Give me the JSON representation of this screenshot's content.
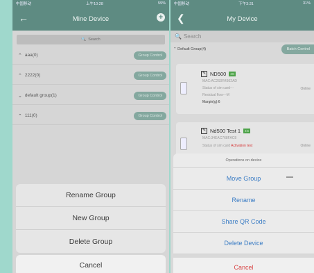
{
  "left": {
    "status": {
      "carrier": "中国移动",
      "time": "上午10:28",
      "battery": "59%"
    },
    "nav": {
      "title": "Mine Device",
      "add_icon": "+"
    },
    "search": {
      "label": "Search"
    },
    "groups": [
      {
        "name": "aaa(0)",
        "button": "Group Control",
        "expanded": false
      },
      {
        "name": "2222(0)",
        "button": "Group Control",
        "expanded": false
      },
      {
        "name": "default group(1)",
        "button": "Group Control",
        "expanded": true
      },
      {
        "name": "111(0)",
        "button": "Group Control",
        "expanded": false
      }
    ],
    "sheet": {
      "options": [
        "Rename Group",
        "New Group",
        "Delete Group"
      ],
      "cancel": "Cancel"
    }
  },
  "right": {
    "status": {
      "carrier": "中国移动",
      "time": "下午3:31",
      "battery": "31%"
    },
    "nav": {
      "title": "My Device"
    },
    "search": {
      "placeholder": "Search"
    },
    "group": {
      "name": "Default Group(4)",
      "batch": "Batch Control"
    },
    "devices": [
      {
        "name": "ND500",
        "badge": "3G",
        "mac": "MAC:AC2S0R4362AD",
        "status": "Status of sim card---",
        "residual": "Residual flow---M",
        "margin": "Margin(g):6",
        "online": "Online"
      },
      {
        "name": "Nd500 Test 1",
        "badge": "4G",
        "mac": "MAC:34EAC768FAC8",
        "status_prefix": "Status of sim card",
        "status_alert": "Activation test",
        "online": "Online"
      }
    ],
    "sheet": {
      "header": "Operations on device",
      "options": [
        "Move Group",
        "Rename",
        "Share QR Code",
        "Delete Device"
      ],
      "cancel": "Cancel"
    }
  }
}
